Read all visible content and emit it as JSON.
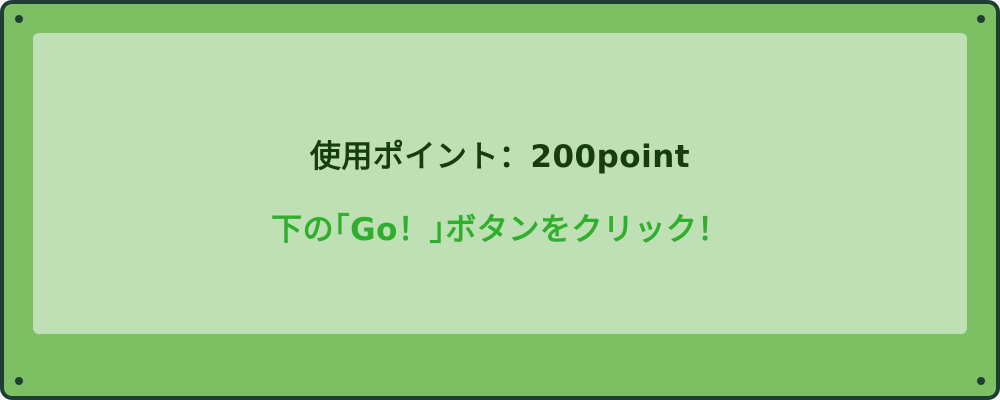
{
  "panel": {
    "points_text": "使用ポイント：200point",
    "instruction_text": "下の｢Go！｣ボタンをクリック！"
  },
  "colors": {
    "frame_background": "#7dc063",
    "frame_border": "#1f3d33",
    "panel_background": "#bfe0b4",
    "points_text_color": "#173d0e",
    "instruction_text_color": "#2fb02c"
  }
}
